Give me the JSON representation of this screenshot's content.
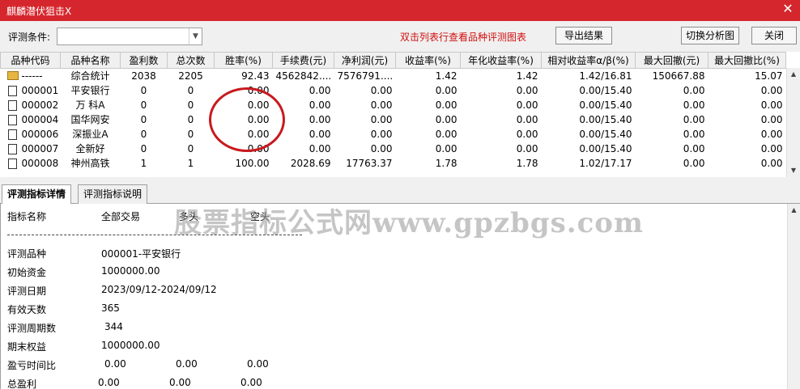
{
  "window": {
    "title": "麒麟潜伏狙击X",
    "close_glyph": "✕"
  },
  "toolbar": {
    "condition_label": "评测条件:",
    "condition_value": "",
    "hint": "双击列表行查看品种评测图表",
    "export_label": "导出结果",
    "switch_label": "切换分析图",
    "close_label": "关闭"
  },
  "table": {
    "columns": [
      "品种代码",
      "品种名称",
      "盈利数",
      "总次数",
      "胜率(%)",
      "手续费(元)",
      "净利润(元)",
      "收益率(%)",
      "年化收益率(%)",
      "相对收益率α/β(%)",
      "最大回撤(元)",
      "最大回撤比(%)"
    ],
    "rows": [
      {
        "icon": "folder-icon",
        "code": "------",
        "name": "综合统计",
        "win": "2038",
        "total": "2205",
        "rate": "92.43",
        "fee": "4562842....",
        "profit": "7576791....",
        "ret": "1.42",
        "annual": "1.42",
        "rel": "1.42/16.81",
        "dd": "150667.88",
        "ddr": "15.07"
      },
      {
        "icon": "document-icon",
        "code": "000001",
        "name": "平安银行",
        "win": "0",
        "total": "0",
        "rate": "0.00",
        "fee": "0.00",
        "profit": "0.00",
        "ret": "0.00",
        "annual": "0.00",
        "rel": "0.00/15.40",
        "dd": "0.00",
        "ddr": "0.00"
      },
      {
        "icon": "document-icon",
        "code": "000002",
        "name": "万 科A",
        "win": "0",
        "total": "0",
        "rate": "0.00",
        "fee": "0.00",
        "profit": "0.00",
        "ret": "0.00",
        "annual": "0.00",
        "rel": "0.00/15.40",
        "dd": "0.00",
        "ddr": "0.00"
      },
      {
        "icon": "document-icon",
        "code": "000004",
        "name": "国华网安",
        "win": "0",
        "total": "0",
        "rate": "0.00",
        "fee": "0.00",
        "profit": "0.00",
        "ret": "0.00",
        "annual": "0.00",
        "rel": "0.00/15.40",
        "dd": "0.00",
        "ddr": "0.00"
      },
      {
        "icon": "document-icon",
        "code": "000006",
        "name": "深振业A",
        "win": "0",
        "total": "0",
        "rate": "0.00",
        "fee": "0.00",
        "profit": "0.00",
        "ret": "0.00",
        "annual": "0.00",
        "rel": "0.00/15.40",
        "dd": "0.00",
        "ddr": "0.00"
      },
      {
        "icon": "document-icon",
        "code": "000007",
        "name": "全新好",
        "win": "0",
        "total": "0",
        "rate": "0.00",
        "fee": "0.00",
        "profit": "0.00",
        "ret": "0.00",
        "annual": "0.00",
        "rel": "0.00/15.40",
        "dd": "0.00",
        "ddr": "0.00"
      },
      {
        "icon": "document-icon",
        "code": "000008",
        "name": "神州高铁",
        "win": "1",
        "total": "1",
        "rate": "100.00",
        "fee": "2028.69",
        "profit": "17763.37",
        "ret": "1.78",
        "annual": "1.78",
        "rel": "1.02/17.17",
        "dd": "0.00",
        "ddr": "0.00"
      }
    ]
  },
  "tabs": [
    {
      "label": "评测指标详情",
      "active": true
    },
    {
      "label": "评测指标说明",
      "active": false
    }
  ],
  "detail": {
    "header": {
      "name": "指标名称",
      "all": "全部交易",
      "long": "多头",
      "short": "空头"
    },
    "items": [
      {
        "label": "评测品种",
        "value": "000001-平安银行"
      },
      {
        "label": "初始资金",
        "value": "1000000.00"
      },
      {
        "label": "评测日期",
        "value": "2023/09/12-2024/09/12"
      },
      {
        "label": "有效天数",
        "value": "365"
      },
      {
        "label": "评测周期数",
        "value": "344"
      },
      {
        "label": "期末权益",
        "value": "1000000.00"
      }
    ],
    "pnl_ratio": {
      "label": "盈亏时间比",
      "all": "0.00",
      "long": "0.00",
      "short": "0.00"
    },
    "total_profit": {
      "label": "总盈利",
      "all": "0.00",
      "long": "0.00",
      "short": "0.00"
    }
  },
  "watermark": "股票指标公式网www.gpzbgs.com",
  "colors": {
    "titlebar": "#d6262d",
    "hint": "#d01010",
    "annotation_circle": "#c8191e"
  }
}
